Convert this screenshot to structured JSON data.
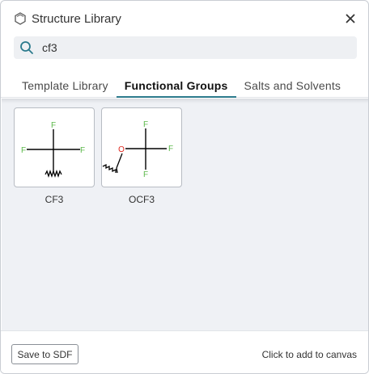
{
  "dialog": {
    "title": "Structure Library",
    "logo_icon": "hexagon-icon",
    "close_icon": "close-icon"
  },
  "search": {
    "icon": "search-icon",
    "value": "cf3",
    "placeholder": ""
  },
  "tabs": [
    {
      "label": "Template Library",
      "active": false
    },
    {
      "label": "Functional Groups",
      "active": true
    },
    {
      "label": "Salts and Solvents",
      "active": false
    }
  ],
  "groups": [
    {
      "name": "CF3",
      "atoms": [
        "F",
        "F",
        "F"
      ]
    },
    {
      "name": "OCF3",
      "atoms": [
        "O",
        "F",
        "F",
        "F"
      ]
    }
  ],
  "footer": {
    "save_label": "Save to SDF",
    "hint": "Click to add to canvas"
  },
  "colors": {
    "accent": "#2b7a8c",
    "fluorine": "#5cb84a",
    "oxygen": "#e0241b"
  }
}
